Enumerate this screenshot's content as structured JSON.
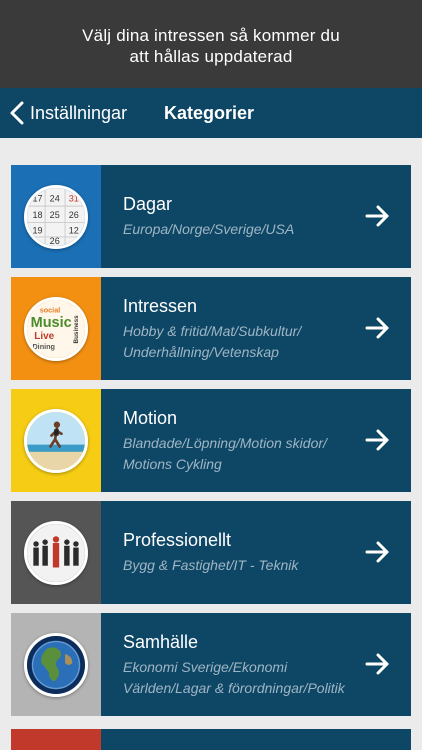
{
  "banner": {
    "line1": "Välj dina intressen så kommer du",
    "line2": "att hållas uppdaterad"
  },
  "navbar": {
    "back_label": "Inställningar",
    "title": "Kategorier"
  },
  "colors": {
    "navy": "#0e4766",
    "banner_bg": "#3a3a3a",
    "background": "#ebebeb",
    "dagar": "#1a6fb5",
    "intressen": "#f39012",
    "motion": "#f6cd14",
    "professionellt": "#555555",
    "samhalle": "#b4b4b4",
    "next": "#c0392b"
  },
  "categories": [
    {
      "title": "Dagar",
      "subtitle": "Europa/Norge/Sverige/USA",
      "icon": "calendar-icon"
    },
    {
      "title": "Intressen",
      "subtitle": "Hobby & fritid/Mat/Subkultur/ Underhållning/Vetenskap",
      "icon": "word-cloud-icon",
      "cloud_words": [
        "social",
        "Music",
        "Live",
        "Dining",
        "Business"
      ]
    },
    {
      "title": "Motion",
      "subtitle": "Blandade/Löpning/Motion skidor/ Motions Cykling",
      "icon": "runner-icon"
    },
    {
      "title": "Professionellt",
      "subtitle": "Bygg & Fastighet/IT - Teknik",
      "icon": "business-people-icon"
    },
    {
      "title": "Samhälle",
      "subtitle": "Ekonomi Sverige/Ekonomi Världen/Lagar & förordningar/Politik",
      "icon": "globe-icon"
    }
  ],
  "calendar_numbers": [
    "17",
    "24",
    "31",
    "25",
    "18",
    "19",
    "26",
    "12",
    "26"
  ]
}
